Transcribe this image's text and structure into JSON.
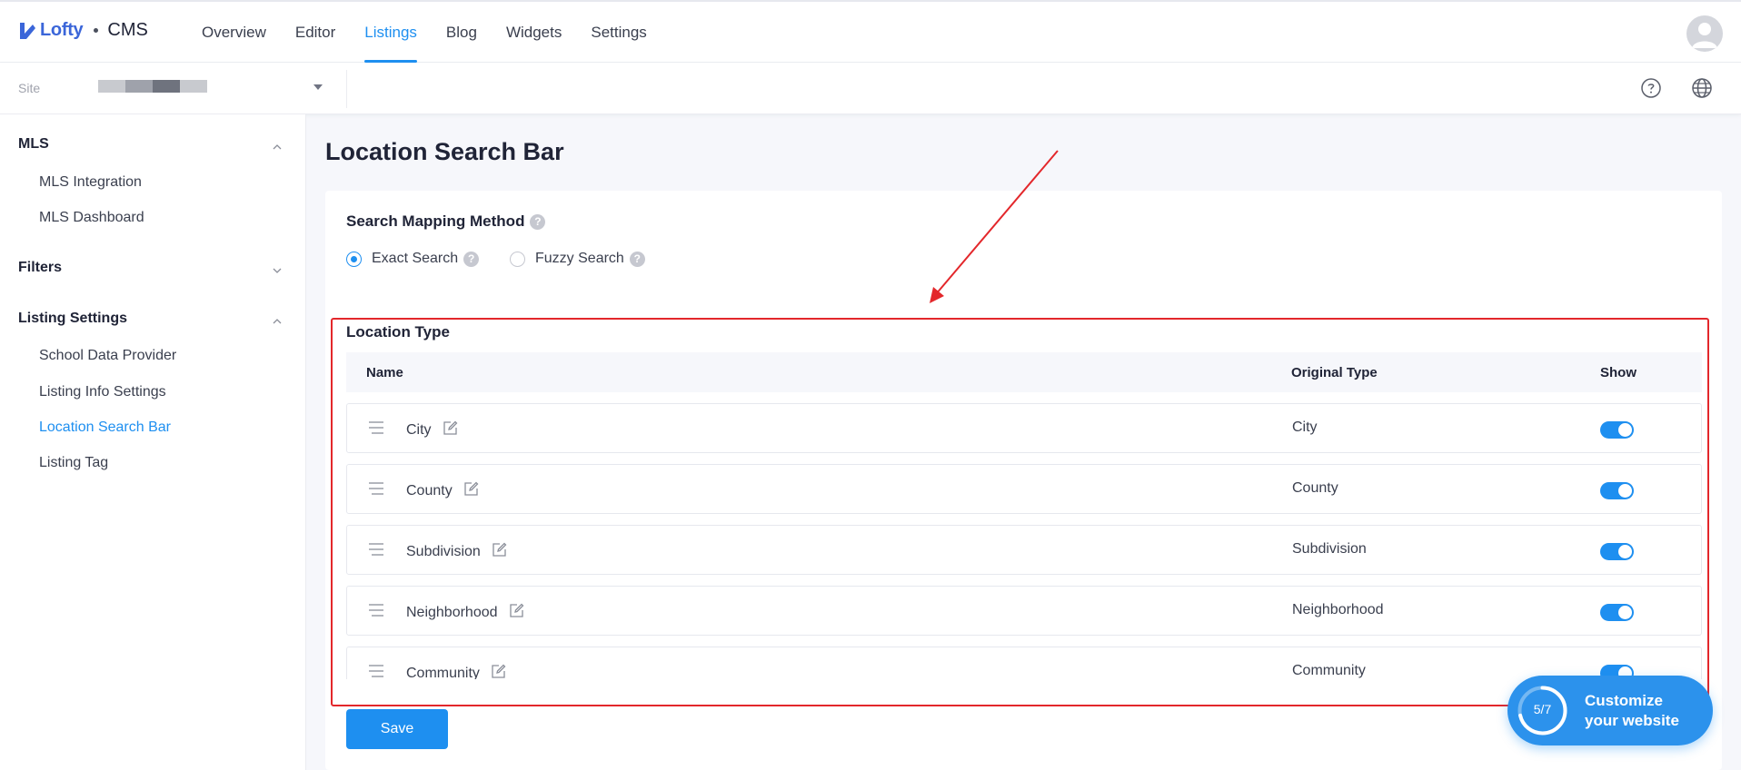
{
  "app": {
    "logo_text": "Lofty",
    "product": "CMS"
  },
  "nav": {
    "tabs": [
      {
        "label": "Overview",
        "active": false
      },
      {
        "label": "Editor",
        "active": false
      },
      {
        "label": "Listings",
        "active": true
      },
      {
        "label": "Blog",
        "active": false
      },
      {
        "label": "Widgets",
        "active": false
      },
      {
        "label": "Settings",
        "active": false
      }
    ]
  },
  "sitebar": {
    "site_label": "Site"
  },
  "sidebar": {
    "groups": [
      {
        "label": "MLS",
        "expanded": true,
        "items": [
          "MLS Integration",
          "MLS Dashboard"
        ]
      },
      {
        "label": "Filters",
        "expanded": false,
        "items": []
      },
      {
        "label": "Listing Settings",
        "expanded": true,
        "items": [
          "School Data Provider",
          "Listing Info Settings",
          "Location Search Bar",
          "Listing Tag"
        ]
      }
    ],
    "active_item": "Location Search Bar"
  },
  "main": {
    "title": "Location Search Bar",
    "mapping": {
      "label": "Search Mapping Method",
      "options": [
        {
          "label": "Exact Search",
          "selected": true
        },
        {
          "label": "Fuzzy Search",
          "selected": false
        }
      ]
    },
    "location_type": {
      "label": "Location Type",
      "columns": {
        "name": "Name",
        "original": "Original Type",
        "show": "Show"
      },
      "rows": [
        {
          "name": "City",
          "original": "City",
          "show": true
        },
        {
          "name": "County",
          "original": "County",
          "show": true
        },
        {
          "name": "Subdivision",
          "original": "Subdivision",
          "show": true
        },
        {
          "name": "Neighborhood",
          "original": "Neighborhood",
          "show": true
        },
        {
          "name": "Community",
          "original": "Community",
          "show": true
        }
      ]
    },
    "save_label": "Save"
  },
  "customize": {
    "progress_text": "5/7",
    "progress": 0.714,
    "line1": "Customize",
    "line2": "your website"
  },
  "colors": {
    "accent": "#1e8ff0",
    "annotation": "#e3272b"
  }
}
